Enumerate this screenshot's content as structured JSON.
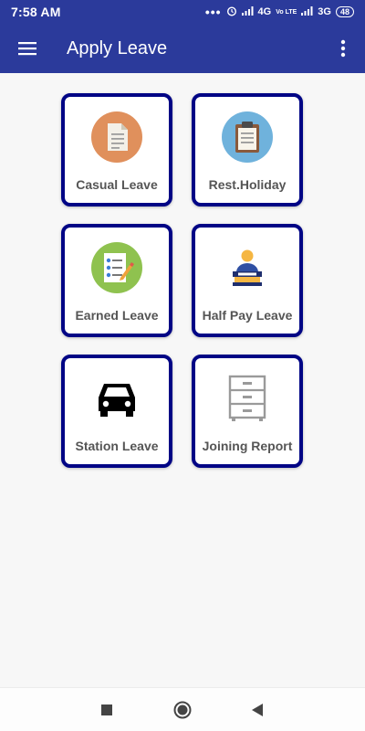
{
  "status_bar": {
    "time": "7:58 AM",
    "dots": "•••",
    "network_1": "4G",
    "volte": "Vo LTE",
    "network_2": "3G",
    "battery": "48"
  },
  "toolbar": {
    "title": "Apply Leave",
    "menu_icon": "hamburger-menu-icon",
    "overflow_icon": "more-vertical-icon"
  },
  "tiles": [
    {
      "label": "Casual Leave",
      "icon": "document-icon"
    },
    {
      "label": "Rest.Holiday",
      "icon": "clipboard-icon"
    },
    {
      "label": "Earned Leave",
      "icon": "checklist-icon"
    },
    {
      "label": "Half Pay Leave",
      "icon": "person-at-desk-icon"
    },
    {
      "label": "Station Leave",
      "icon": "car-icon"
    },
    {
      "label": "Joining Report",
      "icon": "filing-cabinet-icon"
    }
  ],
  "nav_bar": {
    "recents_icon": "square-recents-icon",
    "home_icon": "circle-home-icon",
    "back_icon": "triangle-back-icon"
  },
  "colors": {
    "app_bar": "#2b3a9b",
    "tile_border": "#000585",
    "tile_label": "#555555",
    "background": "#f7f7f7"
  }
}
